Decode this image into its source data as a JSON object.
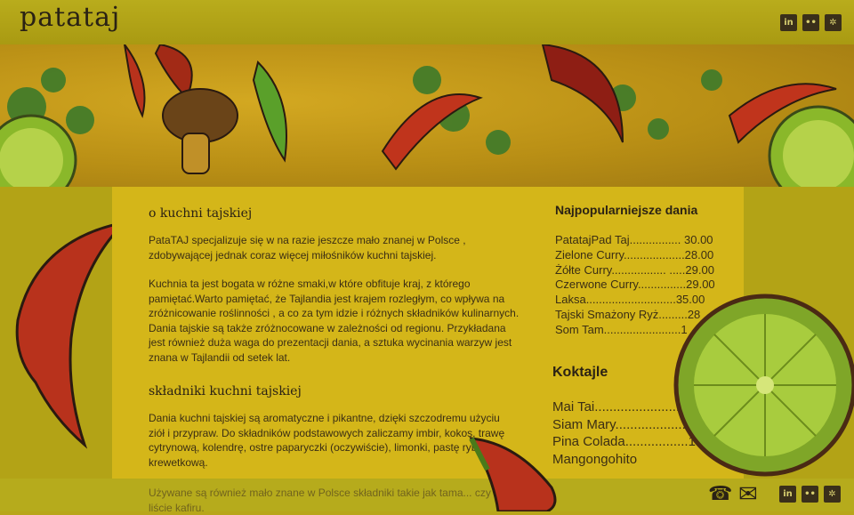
{
  "header": {
    "logo": "patataj"
  },
  "social": [
    "in",
    "flickr",
    "yelp"
  ],
  "social_glyphs": [
    "in",
    "••",
    "✲"
  ],
  "section1": {
    "title": "o kuchni tajskiej",
    "p1": "PataTAJ  specjalizuje się w na razie jeszcze mało znanej w Polsce , zdobywającej jednak coraz więcej miłośników kuchni tajskiej.",
    "p2": "Kuchnia ta jest bogata w różne smaki,w które obfituje kraj, z którego pamiętać.Warto pamiętać, że Tajlandia jest krajem rozległym, co wpływa na zróżnicowanie roślinności , a co za tym idzie i różnych składników kulinarnych. Dania tajskie są także zróżnocowane w zależności od regionu. Przykładana jest również duża waga do prezentacji dania, a sztuka wycinania warzyw jest znana w Tajlandii od setek lat."
  },
  "section2": {
    "title": "składniki kuchni tajskiej",
    "p1": "Dania kuchni tajskiej są aromatyczne i pikantne, dzięki szczodremu użyciu  ziół i przypraw. Do składników podstawowych zaliczamy imbir, kokos, trawę cytrynową, kolendrę, ostre paparyczki (oczywiście), limonki, pastę rybną i krewetkową.",
    "p2": "Używane są również mało znane w Polsce składniki takie jak tama... czy liście kafiru."
  },
  "popular": {
    "title": "Najpopularniejsze dania",
    "items": [
      "PatatajPad Taj................ 30.00",
      "Zielone Curry...................28.00",
      "Żółte Curry................. .....29.00",
      "Czerwone Curry...............29.00",
      "Laksa............................35.00",
      "Tajski Smażony Ryż.........28",
      "Som Tam........................1"
    ]
  },
  "cocktails": {
    "title": "Koktajle",
    "items": [
      "Mai Tai........................",
      "Siam Mary...................1",
      "Pina Colada.................18",
      "Mangongohito"
    ]
  },
  "contact": {
    "phone_glyph": "☎",
    "mail_glyph": "✉"
  },
  "colors": {
    "background": "#b8a61a",
    "panel": "#d4b619",
    "text": "#3b2e14",
    "chili": "#b8321c",
    "lime": "#8ab82a"
  }
}
